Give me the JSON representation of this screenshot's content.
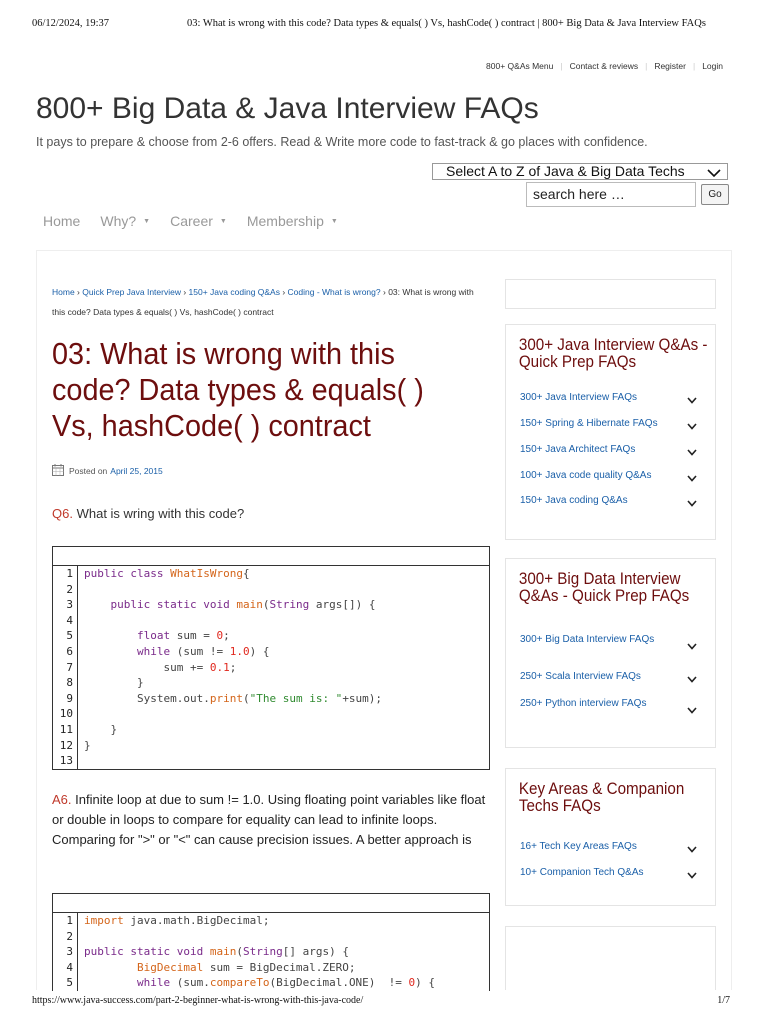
{
  "print_header": {
    "datetime": "06/12/2024, 19:37",
    "page_title": "03: What is wrong with this code? Data types & equals( ) Vs, hashCode( ) contract | 800+ Big Data & Java Interview FAQs"
  },
  "print_footer": {
    "url": "https://www.java-success.com/part-2-beginner-what-is-wrong-with-this-java-code/",
    "page": "1/7"
  },
  "top_nav": [
    "800+ Q&As Menu",
    "Contact & reviews",
    "Register",
    "Login"
  ],
  "site": {
    "title": "800+ Big Data & Java Interview FAQs",
    "tagline": "It pays to prepare & choose from 2-6 offers. Read & Write more code to fast-track & go places with confidence."
  },
  "tech_select": {
    "value": "Select A to Z of Java & Big Data Techs"
  },
  "search": {
    "placeholder": "search here …",
    "go_label": "Go"
  },
  "main_nav": [
    {
      "label": "Home"
    },
    {
      "label": "Why?"
    },
    {
      "label": "Career"
    },
    {
      "label": "Membership"
    }
  ],
  "breadcrumb": {
    "links": [
      "Home",
      "Quick Prep Java Interview",
      "150+ Java coding Q&As",
      "Coding - What is wrong?"
    ],
    "current": "03: What is wrong with this code? Data types & equals( ) Vs, hashCode( ) contract"
  },
  "article": {
    "title": "03: What is wrong with this code? Data types & equals( ) Vs, hashCode( ) contract",
    "posted_label": "Posted on",
    "posted_date": "April 25, 2015",
    "q_label": "Q6.",
    "q_text": "What is wring with this code?",
    "a_label": "A6.",
    "a_text": "Infinite loop at due to sum != 1.0. Using floating point variables like float or double in loops to compare for equality can lead to infinite loops. Comparing for \">\" or \"<\" can cause precision issues. A better approach is"
  },
  "code1": [
    [
      [
        "kw",
        "public class "
      ],
      [
        "cls",
        "WhatIsWrong"
      ],
      [
        "",
        "{"
      ]
    ],
    [],
    [
      [
        "",
        "    "
      ],
      [
        "kw",
        "public static void "
      ],
      [
        "cls",
        "main"
      ],
      [
        "",
        "("
      ],
      [
        "typ",
        "String"
      ],
      [
        "",
        " args[]) {"
      ]
    ],
    [],
    [
      [
        "",
        "        "
      ],
      [
        "kw",
        "float"
      ],
      [
        "",
        " sum = "
      ],
      [
        "num",
        "0"
      ],
      [
        "",
        ";"
      ]
    ],
    [
      [
        "",
        "        "
      ],
      [
        "kw",
        "while"
      ],
      [
        "",
        " (sum != "
      ],
      [
        "num",
        "1.0"
      ],
      [
        "",
        ") {"
      ]
    ],
    [
      [
        "",
        "            sum += "
      ],
      [
        "num",
        "0.1"
      ],
      [
        "",
        ";"
      ]
    ],
    [
      [
        "",
        "        }"
      ]
    ],
    [
      [
        "",
        "        System.out."
      ],
      [
        "cls",
        "print"
      ],
      [
        "",
        "("
      ],
      [
        "str",
        "\"The sum is: \""
      ],
      [
        "",
        "+sum);"
      ]
    ],
    [],
    [
      [
        "",
        "    }"
      ]
    ],
    [
      [
        "",
        "}"
      ]
    ],
    []
  ],
  "code2": [
    [
      [
        "cls",
        "import"
      ],
      [
        "",
        " java.math.BigDecimal;"
      ]
    ],
    [],
    [
      [
        "kw",
        "public static void "
      ],
      [
        "cls",
        "main"
      ],
      [
        "",
        "("
      ],
      [
        "typ",
        "String"
      ],
      [
        "",
        "[] args) {"
      ]
    ],
    [
      [
        "",
        "        "
      ],
      [
        "cls",
        "BigDecimal"
      ],
      [
        "",
        " sum = BigDecimal.ZERO;"
      ]
    ],
    [
      [
        "",
        "        "
      ],
      [
        "kw",
        "while"
      ],
      [
        "",
        " (sum."
      ],
      [
        "cls",
        "compareTo"
      ],
      [
        "",
        "(BigDecimal.ONE)  != "
      ],
      [
        "num",
        "0"
      ],
      [
        "",
        ") {"
      ]
    ]
  ],
  "sidebar": [
    {
      "heading": "300+ Java Interview Q&As - Quick Prep FAQs",
      "items": [
        "300+ Java Interview FAQs",
        "150+ Spring & Hibernate FAQs",
        "150+ Java Architect FAQs",
        "100+ Java code quality Q&As",
        "150+ Java coding Q&As"
      ]
    },
    {
      "heading": "300+ Big Data Interview Q&As - Quick Prep FAQs",
      "items": [
        "300+ Big Data Interview FAQs",
        "250+ Scala Interview FAQs",
        "250+ Python interview FAQs"
      ]
    },
    {
      "heading": "Key Areas & Companion Techs FAQs",
      "items": [
        "16+ Tech Key Areas FAQs",
        "10+ Companion Tech Q&As"
      ]
    }
  ]
}
